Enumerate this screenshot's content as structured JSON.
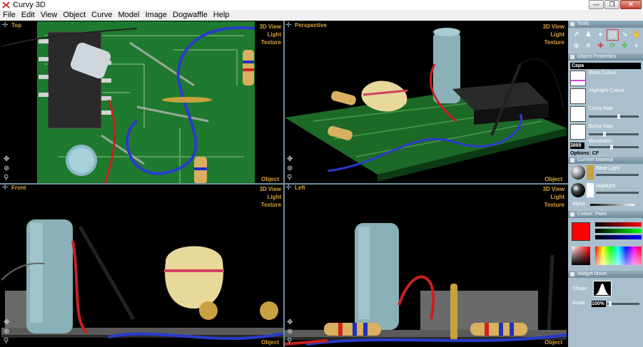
{
  "window": {
    "title": "Curvy 3D"
  },
  "menu": [
    "File",
    "Edit",
    "View",
    "Object",
    "Curve",
    "Model",
    "Image",
    "Dogwaffle",
    "Help"
  ],
  "viewports": {
    "top": {
      "name": "Top",
      "options": [
        "3D View",
        "Light",
        "Texture"
      ],
      "footer": "Object"
    },
    "perspective": {
      "name": "Perspective",
      "options": [
        "3D View",
        "Light",
        "Texture"
      ],
      "footer": "Object"
    },
    "front": {
      "name": "Front",
      "options": [
        "3D View",
        "Light",
        "Texture"
      ],
      "footer": "Object"
    },
    "left": {
      "name": "Left",
      "options": [
        "3D View",
        "Light",
        "Texture"
      ],
      "footer": "Object"
    }
  },
  "panel": {
    "tools": {
      "title": "Tools"
    },
    "object_properties": {
      "title": "Object Properties",
      "name": "Capa",
      "count": "1",
      "base_colour": "Base Colour",
      "highlight_colour": "Highlight Colour",
      "curvy_map": "Curvy Map",
      "bump_map": "Bump Map",
      "resolution_label": "Resolution",
      "resolution_value": "3888",
      "options": "Options: CF"
    },
    "current_material": {
      "title": "Current Material",
      "base_light": "Base Light",
      "highlight": "Highlight",
      "alpha": "Alpha"
    },
    "colour": {
      "title": "Colour: Paint",
      "current": "#ff0000"
    },
    "widget": {
      "title": "Widget Move",
      "shape": "Shape",
      "scale_label": "Scale",
      "scale_value": "100%"
    }
  }
}
